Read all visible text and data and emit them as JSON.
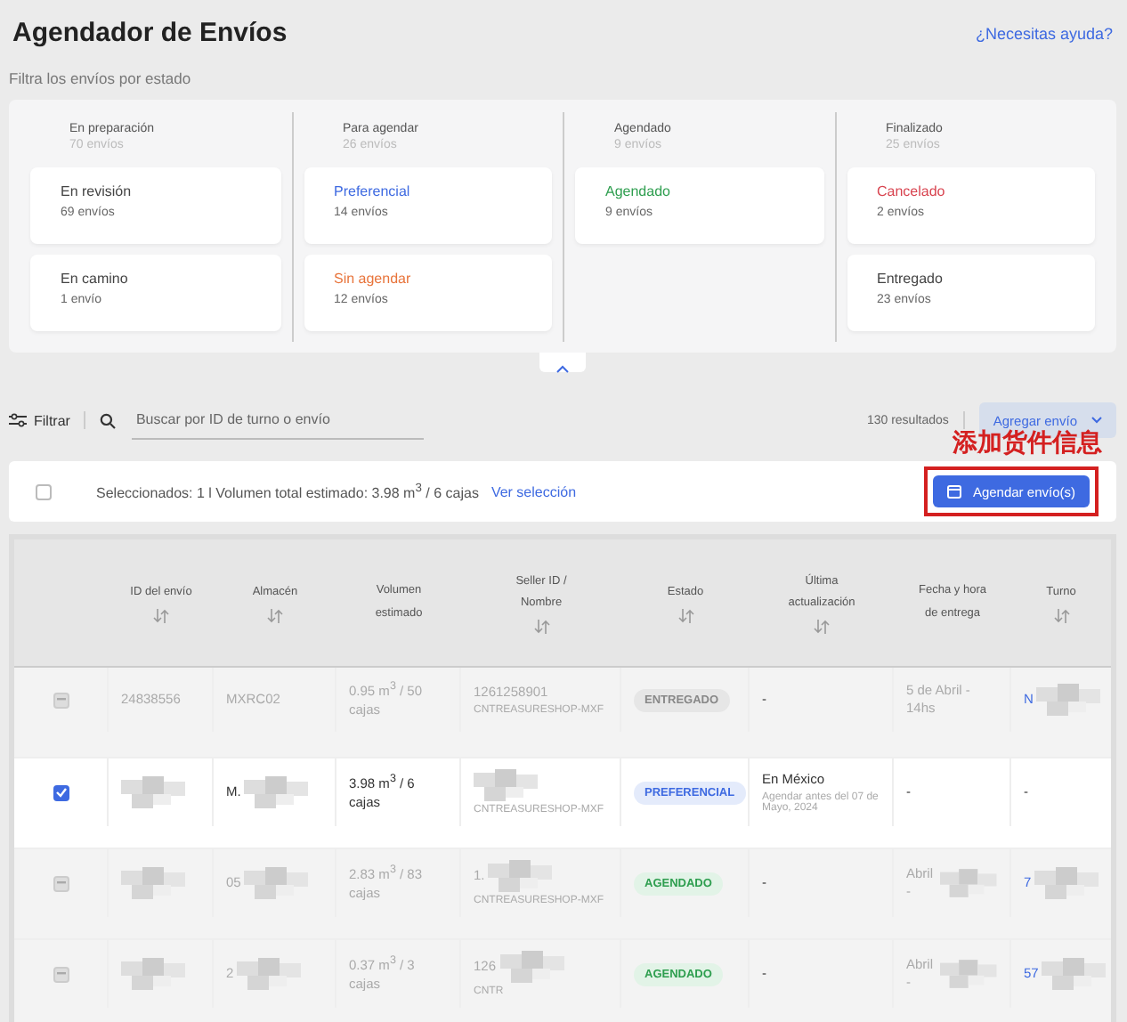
{
  "header": {
    "title": "Agendador de Envíos",
    "help_link": "¿Necesitas ayuda?",
    "subtitle": "Filtra los envíos por estado"
  },
  "status_groups": [
    {
      "title": "En preparación",
      "count": "70 envíos",
      "cards": [
        {
          "label": "En revisión",
          "count": "69 envíos",
          "color": "#444444"
        },
        {
          "label": "En camino",
          "count": "1 envío",
          "color": "#444444"
        }
      ]
    },
    {
      "title": "Para agendar",
      "count": "26 envíos",
      "cards": [
        {
          "label": "Preferencial",
          "count": "14 envíos",
          "color": "#3e6ae1"
        },
        {
          "label": "Sin agendar",
          "count": "12 envíos",
          "color": "#e8743b"
        }
      ]
    },
    {
      "title": "Agendado",
      "count": "9 envíos",
      "cards": [
        {
          "label": "Agendado",
          "count": "9 envíos",
          "color": "#2e9e4f"
        }
      ]
    },
    {
      "title": "Finalizado",
      "count": "25 envíos",
      "cards": [
        {
          "label": "Cancelado",
          "count": "2 envíos",
          "color": "#d8434f"
        },
        {
          "label": "Entregado",
          "count": "23 envíos",
          "color": "#444444"
        }
      ]
    }
  ],
  "panel_expanded": true,
  "toolbar": {
    "filter": "Filtrar",
    "search_placeholder": "Buscar por ID de turno o envío",
    "results": "130 resultados",
    "add_button": "Agregar envío"
  },
  "selection_bar": {
    "checked": false,
    "summary": "Seleccionados: 1 l Volumen total estimado: 3.98 m$^{3}$ / 6 cajas",
    "view_link": "Ver selección",
    "schedule_button": "Agendar envío(s)",
    "annotation": "添加货件信息"
  },
  "table": {
    "columns": [
      {
        "label": "ID del envío",
        "sortable": true
      },
      {
        "label": "Almacén",
        "sortable": true
      },
      {
        "label": "Volumen estimado",
        "sortable": false
      },
      {
        "label": "Seller ID / Nombre",
        "sortable": true
      },
      {
        "label": "Estado",
        "sortable": true
      },
      {
        "label": "Última actualización",
        "sortable": true
      },
      {
        "label": "Fecha y hora de entrega",
        "sortable": false
      },
      {
        "label": "Turno",
        "sortable": true
      }
    ],
    "rows": [
      {
        "checked": false,
        "disabled": true,
        "id": {
          "text": "24838556",
          "redacted": false
        },
        "warehouse": {
          "text": "MXRC02",
          "redacted": false
        },
        "volume": "0.95 m$^{3}$ / 50 cajas",
        "seller_id": {
          "text": "1261258901",
          "redacted": false
        },
        "seller_name": "CNTREASURESHOP-MXF",
        "status": {
          "label": "ENTREGADO",
          "kind": "delivered"
        },
        "update": {
          "title": "-"
        },
        "delivery": {
          "text": "5 de Abril - 14hs",
          "redacted": false
        },
        "slot": {
          "text": "N",
          "redacted": true
        }
      },
      {
        "checked": true,
        "disabled": false,
        "id": {
          "redacted": true
        },
        "warehouse": {
          "text": "M.",
          "redacted": true
        },
        "volume": "3.98 m$^{3}$ / 6 cajas",
        "seller_id": {
          "redacted": true
        },
        "seller_name": "CNTREASURESHOP-MXF",
        "status": {
          "label": "PREFERENCIAL",
          "kind": "preferred"
        },
        "update": {
          "title": "En México",
          "note": "Agendar antes del 07 de Mayo, 2024"
        },
        "delivery": {
          "text": "-",
          "redacted": false
        },
        "slot": {
          "text": "-",
          "redacted": false
        }
      },
      {
        "checked": false,
        "disabled": true,
        "id": {
          "redacted": true
        },
        "warehouse": {
          "text": "05",
          "redacted": true
        },
        "volume": "2.83 m$^{3}$ / 83 cajas",
        "seller_id": {
          "text": "1.",
          "redacted": true
        },
        "seller_name": "CNTREASURESHOP-MXF",
        "status": {
          "label": "AGENDADO",
          "kind": "scheduled"
        },
        "update": {
          "title": "-"
        },
        "delivery": {
          "text": "Abril -",
          "redacted": true
        },
        "slot": {
          "text": "7",
          "redacted": true
        }
      },
      {
        "checked": false,
        "disabled": true,
        "id": {
          "redacted": true
        },
        "warehouse": {
          "text": "2",
          "redacted": true
        },
        "volume": "0.37 m$^{3}$ / 3 cajas",
        "seller_id": {
          "text": "126",
          "redacted": true
        },
        "seller_name": "CNTR",
        "status": {
          "label": "AGENDADO",
          "kind": "scheduled"
        },
        "update": {
          "title": "-"
        },
        "delivery": {
          "text": "Abril -",
          "redacted": true
        },
        "slot": {
          "text": "57",
          "redacted": true
        }
      }
    ]
  }
}
